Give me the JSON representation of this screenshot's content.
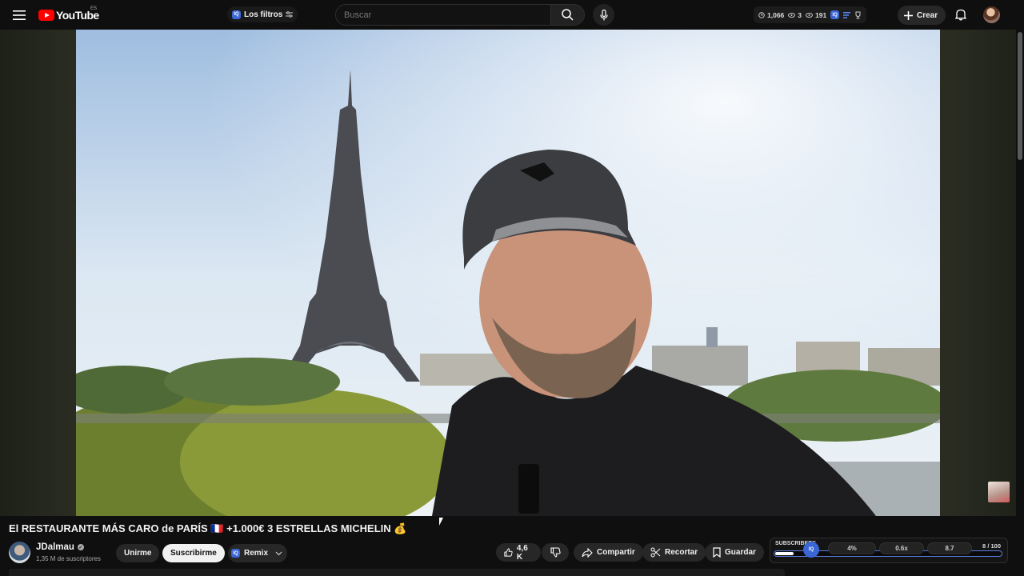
{
  "header": {
    "logo_text": "YouTube",
    "region": "ES",
    "filter_chip": {
      "badge": "IQ",
      "label": "Los filtros"
    },
    "search": {
      "placeholder": "Buscar"
    },
    "stats": [
      {
        "icon": "clock-icon",
        "value": "1,066"
      },
      {
        "icon": "eye-icon",
        "value": "3"
      },
      {
        "icon": "eye-icon",
        "value": "191"
      }
    ],
    "create_label": "Crear"
  },
  "video": {
    "title": "El RESTAURANTE MÁS CARO de PARÍS 🇫🇷 +1.000€ 3 ESTRELLAS MICHELIN 💰"
  },
  "channel": {
    "name": "JDalmau",
    "subscribers": "1,35 M de suscriptores",
    "join_label": "Unirme",
    "subscribe_label": "Suscribirme",
    "remix_badge": "IQ",
    "remix_label": "Remix"
  },
  "actions": {
    "likes": "4,6 K",
    "share_label": "Compartir",
    "clip_label": "Recortar",
    "save_label": "Guardar"
  },
  "metrics_panel": {
    "label": "SUBSCRIBERS",
    "badge": "IQ",
    "progress": 0.08,
    "segments": [
      "4%",
      "0.6x",
      "8.7"
    ],
    "score": "8",
    "score_max": "/ 100"
  },
  "colors": {
    "background": "#0f0f0f",
    "brand_red": "#ff0000",
    "extension_blue": "#3b67d6"
  }
}
